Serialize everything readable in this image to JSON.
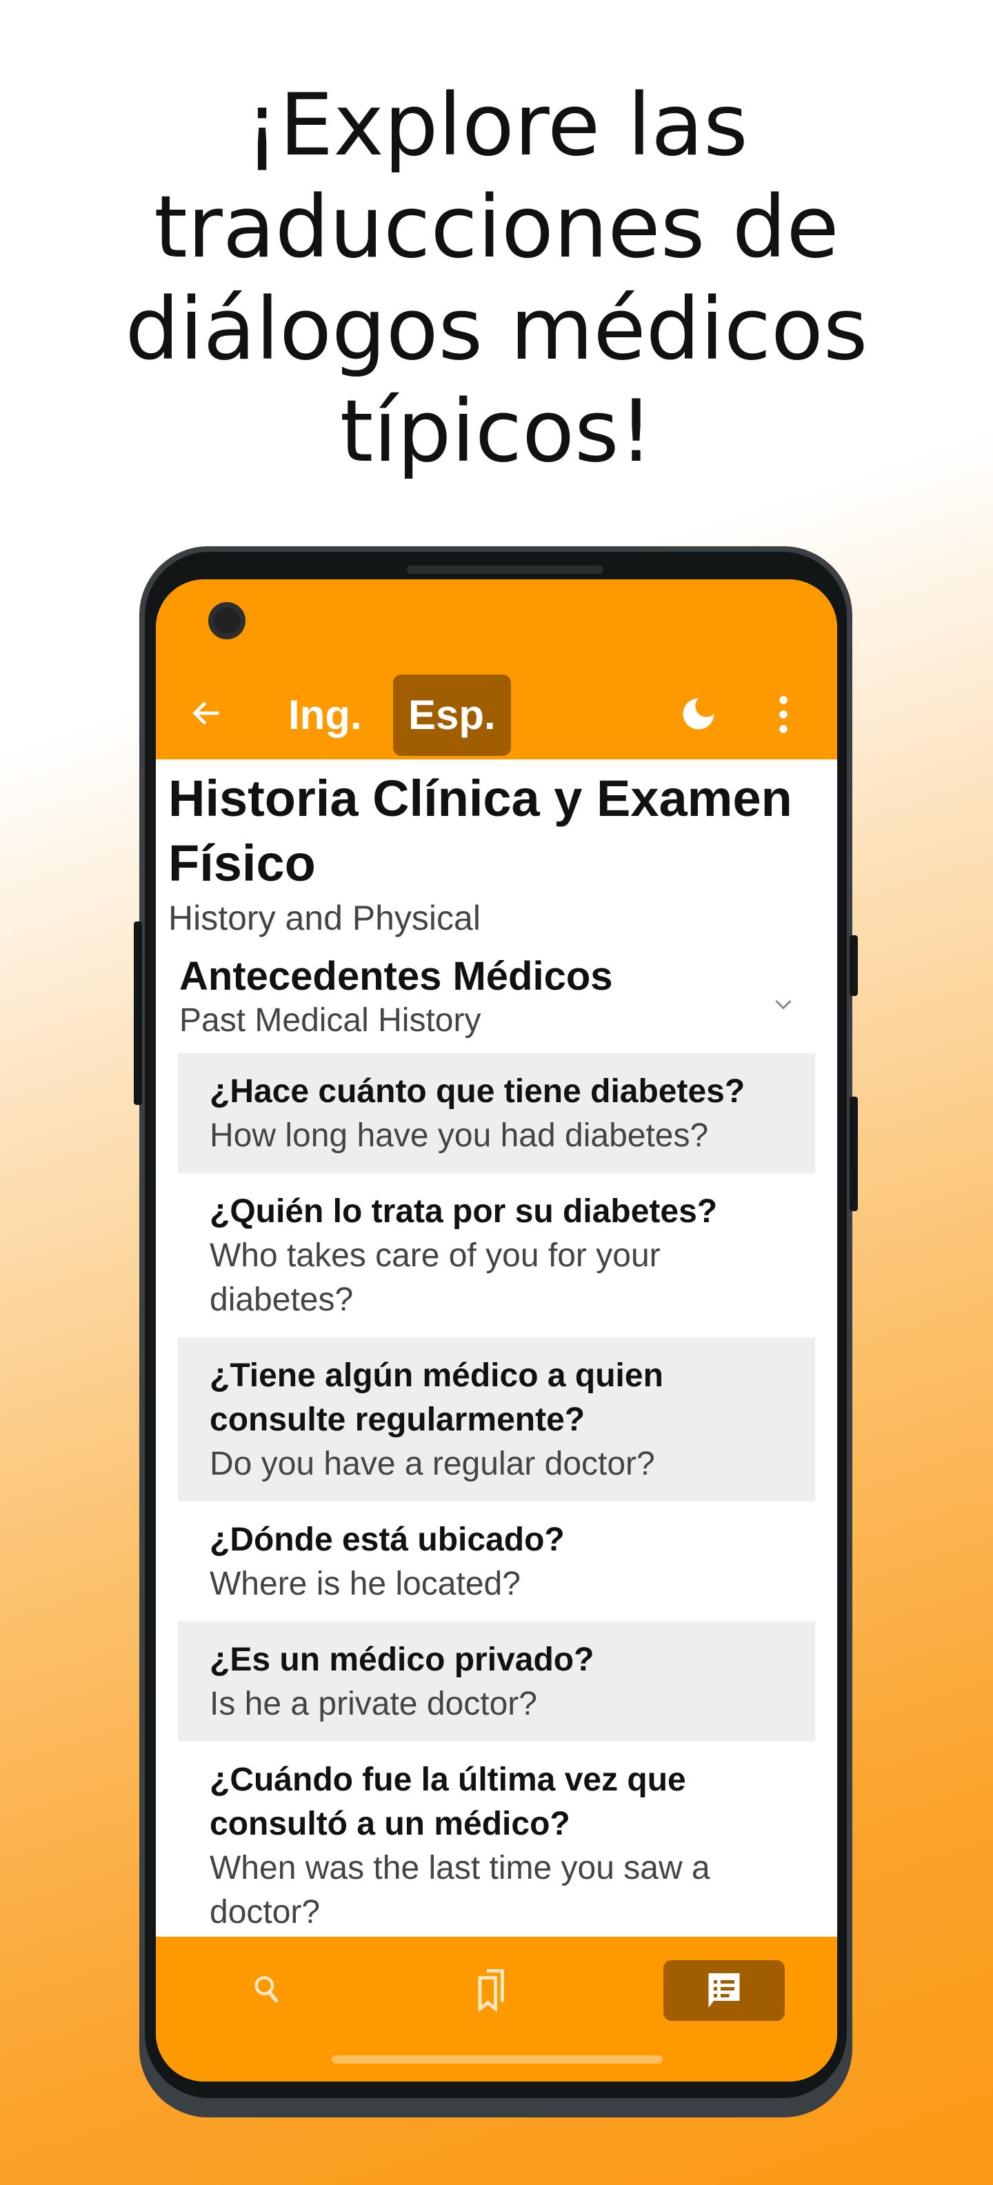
{
  "headline": "¡Explore las traducciones de diálogos médicos típicos!",
  "colors": {
    "accent": "#ff9900",
    "accent_dark": "#a05e00",
    "row_alt": "#eeeeee"
  },
  "toolbar": {
    "back_icon": "arrow-left-icon",
    "lang_en": "Ing.",
    "lang_es": "Esp.",
    "active_lang": "Esp.",
    "theme_icon": "moon-icon",
    "menu_icon": "more-vertical-icon"
  },
  "page": {
    "title": "Historia Clínica y Examen Físico",
    "subtitle": "History and Physical"
  },
  "section": {
    "title": "Antecedentes Médicos",
    "subtitle": "Past Medical History",
    "expand_icon": "chevron-down-icon"
  },
  "items": [
    {
      "q": "¿Hace cuánto que tiene diabetes?",
      "a": "How long have you had diabetes?"
    },
    {
      "q": "¿Quién lo trata por su diabetes?",
      "a": "Who takes care of you for your diabetes?"
    },
    {
      "q": "¿Tiene algún médico a quien consulte regularmente?",
      "a": "Do you have a regular doctor?"
    },
    {
      "q": "¿Dónde está ubicado?",
      "a": "Where is he located?"
    },
    {
      "q": "¿Es un médico privado?",
      "a": "Is he a private doctor?"
    },
    {
      "q": "¿Cuándo fue la última vez que consultó a un médico?",
      "a": "When was the last time you saw a doctor?"
    }
  ],
  "bottom_nav": [
    {
      "icon": "search-icon"
    },
    {
      "icon": "bookmarks-icon"
    },
    {
      "icon": "dialogue-icon",
      "selected": true
    }
  ]
}
